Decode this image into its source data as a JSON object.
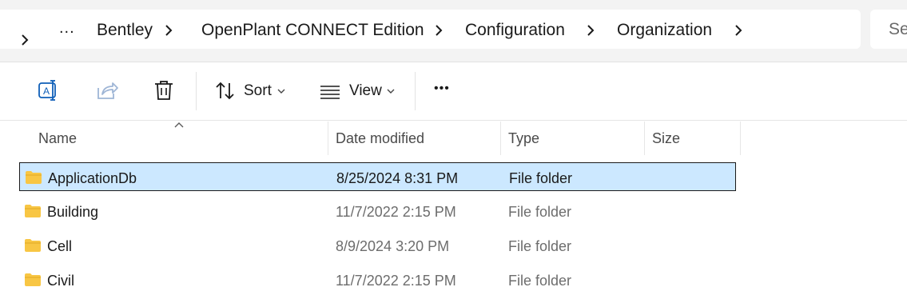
{
  "address_bar": {
    "breadcrumbs": [
      "Bentley",
      "OpenPlant CONNECT Edition",
      "Configuration",
      "Organization"
    ],
    "overflow": "...",
    "search_placeholder": "Se"
  },
  "command_bar": {
    "rename_icon": "rename-icon",
    "share_icon": "share-icon",
    "delete_icon": "trash-icon",
    "sort_label": "Sort",
    "view_label": "View",
    "more_label": "•••"
  },
  "columns": [
    "Name",
    "Date modified",
    "Type",
    "Size"
  ],
  "rows": [
    {
      "name": "ApplicationDb",
      "date": "8/25/2024 8:31 PM",
      "type": "File folder",
      "selected": true
    },
    {
      "name": "Building",
      "date": "11/7/2022 2:15 PM",
      "type": "File folder",
      "selected": false
    },
    {
      "name": "Cell",
      "date": "8/9/2024 3:20 PM",
      "type": "File folder",
      "selected": false
    },
    {
      "name": "Civil",
      "date": "11/7/2022 2:15 PM",
      "type": "File folder",
      "selected": false
    }
  ],
  "colors": {
    "selection_bg": "#cce8ff",
    "folder": "#f8c644",
    "share_disabled": "#9fb6d6",
    "accent_icon": "#0f5fb8"
  }
}
